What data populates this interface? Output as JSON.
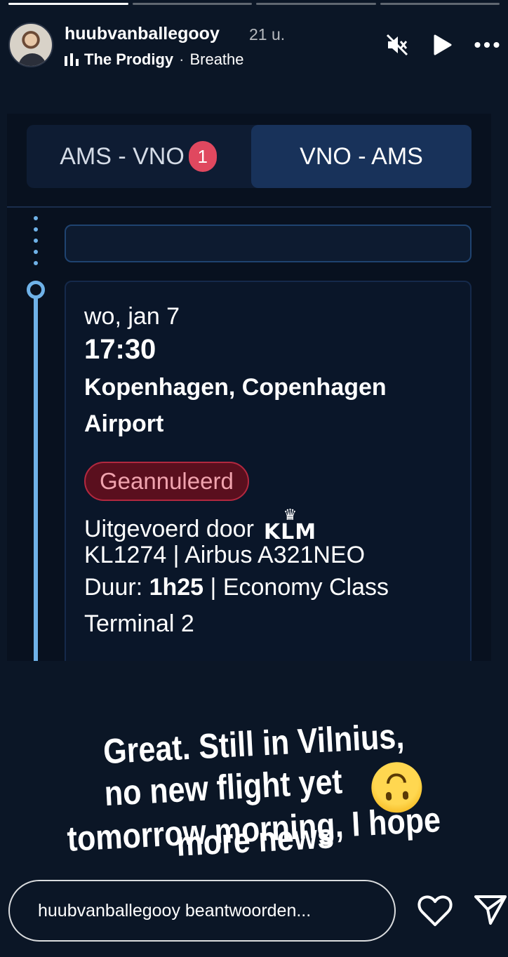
{
  "story": {
    "progress_segments": [
      1.0,
      0.0,
      0.0,
      0.0
    ],
    "user": {
      "username": "huubvanballegooy",
      "time_ago": "21 u."
    },
    "music": {
      "artist": "The Prodigy",
      "separator": "·",
      "song": "Breathe"
    },
    "icons": {
      "mute": "muted-speaker-icon",
      "play": "play-icon",
      "more": "more-icon"
    }
  },
  "screenshot": {
    "tabs": [
      {
        "label": "AMS - VNO",
        "badge": "1",
        "selected": false
      },
      {
        "label": "VNO - AMS",
        "selected": true
      }
    ],
    "flight": {
      "date": "wo, jan 7",
      "time": "17:30",
      "place": "Kopenhagen, Copenhagen Airport",
      "status": "Geannuleerd",
      "operated_by": "Uitgevoerd door",
      "airline_logo": "KLM",
      "flight_info": "KL1274 | Airbus A321NEO",
      "duration_label": "Duur:",
      "duration": "1h25",
      "class": "| Economy Class",
      "terminal": "Terminal 2"
    },
    "colors": {
      "accent": "#6fb2e8",
      "cancel": "#b2283f"
    }
  },
  "caption": {
    "line1": "Great. Still in Vilnius,",
    "line2a": "no new flight yet",
    "line2b": "more news",
    "line3": "tomorrow morning, I hope",
    "emoji": "upside-down-face"
  },
  "reply": {
    "placeholder": "huubvanballegooy beantwoorden..."
  }
}
